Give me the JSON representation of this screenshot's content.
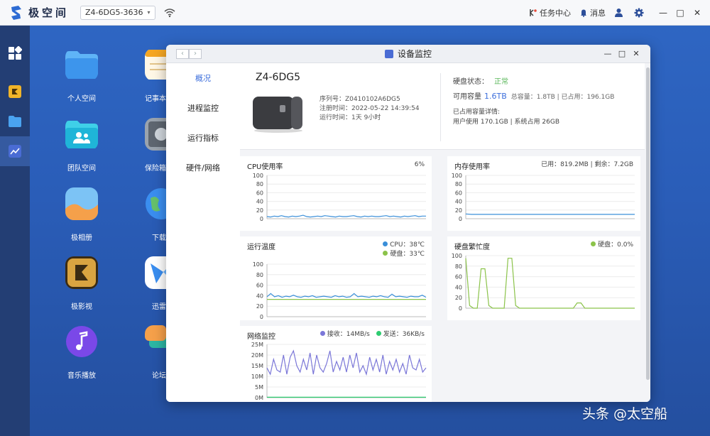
{
  "topbar": {
    "brand": "极空间",
    "device": "Z4-6DG5-3636",
    "tasks": "任务中心",
    "messages": "消息"
  },
  "apps": [
    {
      "label": "个人空间"
    },
    {
      "label": "记事本"
    },
    {
      "label": "团队空间"
    },
    {
      "label": "保险箱"
    },
    {
      "label": "极相册"
    },
    {
      "label": "下载"
    },
    {
      "label": "极影视"
    },
    {
      "label": "迅雷"
    },
    {
      "label": "音乐播放"
    },
    {
      "label": "论坛"
    }
  ],
  "window": {
    "title": "设备监控",
    "nav": [
      "概况",
      "进程监控",
      "运行指标",
      "硬件/网络"
    ],
    "device_name": "Z4-6DG5",
    "serial": "序列号：Z0410102A6DG5",
    "registered": "注册时间：2022-05-22 14:39:54",
    "uptime": "运行时间：1天 9小时",
    "disk_status_label": "硬盘状态：",
    "disk_status": "正常",
    "avail_label": "可用容量",
    "avail_value": "1.6TB",
    "capacity_detail": "总容量：1.8TB | 已占用：196.1GB",
    "used_detail_label": "已占用容量详情:",
    "used_detail": "用户使用 170.1GB | 系统占用 26GB"
  },
  "colors": {
    "accent": "#3d6fdc",
    "cpu_line": "#3a8fd9",
    "disk_line": "#8bc34a",
    "net_recv": "#7b77d8",
    "net_send": "#2ecc71"
  },
  "chart_data": [
    {
      "type": "line",
      "title": "CPU使用率",
      "legend": "6%",
      "ylim": [
        0,
        100
      ],
      "yticks": [
        "100",
        "80",
        "60",
        "40",
        "20",
        "0"
      ],
      "series": [
        {
          "values": [
            5,
            4,
            6,
            5,
            7,
            5,
            4,
            6,
            5,
            6,
            8,
            5,
            4,
            5,
            6,
            5,
            7,
            6,
            5,
            4,
            6,
            5,
            5,
            6,
            7,
            5,
            4,
            6,
            5,
            6,
            5,
            5,
            6,
            7,
            5,
            6,
            5,
            4,
            6,
            5,
            6,
            7,
            5,
            6,
            6
          ]
        }
      ]
    },
    {
      "type": "line",
      "title": "内存使用率",
      "legend": "已用：819.2MB | 剩余：7.2GB",
      "ylim": [
        0,
        100
      ],
      "yticks": [
        "100",
        "80",
        "60",
        "40",
        "20",
        "0"
      ],
      "series": [
        {
          "values": [
            11,
            10,
            10,
            10,
            10,
            10,
            10,
            10,
            10,
            10,
            10,
            10,
            10,
            10,
            10,
            10,
            10,
            10,
            10,
            10,
            10,
            10,
            10,
            10,
            10,
            10,
            10,
            10,
            10,
            10
          ]
        }
      ]
    },
    {
      "type": "line",
      "title": "运行温度",
      "legend_cpu": "CPU：38℃",
      "legend_disk": "硬盘：33℃",
      "ylim": [
        0,
        100
      ],
      "yticks": [
        "100",
        "80",
        "60",
        "40",
        "20",
        "0"
      ],
      "series": [
        {
          "name": "CPU",
          "values": [
            38,
            44,
            38,
            40,
            37,
            39,
            38,
            41,
            38,
            37,
            39,
            38,
            40,
            37,
            38,
            39,
            38,
            37,
            40,
            38,
            39,
            37,
            38,
            44,
            38,
            39,
            38,
            37,
            39,
            38,
            40,
            38,
            37,
            43,
            38,
            39,
            38,
            37,
            39,
            38,
            38,
            41,
            37
          ]
        },
        {
          "name": "硬盘",
          "values": [
            33,
            33,
            33,
            33,
            33,
            33,
            33,
            33,
            33,
            33,
            33,
            33,
            33,
            33,
            33,
            33,
            33,
            33,
            33,
            33,
            33,
            33,
            33,
            33,
            33,
            33,
            33,
            33,
            33,
            33,
            33,
            33,
            33,
            33,
            33,
            33,
            33,
            33,
            33,
            33,
            33,
            33,
            33
          ]
        }
      ]
    },
    {
      "type": "line",
      "title": "硬盘繁忙度",
      "legend": "硬盘：0.0%",
      "ylim": [
        0,
        100
      ],
      "yticks": [
        "100",
        "80",
        "60",
        "40",
        "20",
        "0"
      ],
      "series": [
        {
          "values": [
            95,
            5,
            0,
            0,
            75,
            75,
            5,
            0,
            0,
            0,
            0,
            95,
            95,
            5,
            0,
            0,
            0,
            0,
            0,
            0,
            0,
            0,
            0,
            0,
            0,
            0,
            0,
            0,
            0,
            10,
            10,
            0,
            0,
            0,
            0,
            0,
            0,
            0,
            0,
            0,
            0,
            0,
            0,
            0,
            0
          ]
        }
      ]
    },
    {
      "type": "line",
      "title": "网络监控",
      "legend_recv": "接收：14MB/s",
      "legend_send": "发送：36KB/s",
      "ylim": [
        0,
        25
      ],
      "yticks": [
        "25M",
        "20M",
        "15M",
        "10M",
        "5M",
        "0M"
      ],
      "series": [
        {
          "name": "接收",
          "values": [
            14,
            11,
            18,
            13,
            12,
            20,
            11,
            19,
            22,
            15,
            12,
            18,
            13,
            21,
            11,
            20,
            14,
            12,
            16,
            22,
            12,
            17,
            13,
            19,
            12,
            20,
            14,
            21,
            12,
            15,
            11,
            19,
            13,
            18,
            12,
            20,
            11,
            17,
            13,
            18,
            12,
            16,
            11,
            20,
            14,
            13,
            18,
            12,
            14
          ]
        },
        {
          "name": "发送",
          "values": [
            0.2,
            0.2,
            0.2,
            0.2,
            0.2,
            0.2,
            0.2,
            0.2,
            0.2,
            0.2,
            0.2,
            0.2,
            0.2,
            0.2,
            0.2,
            0.2,
            0.2,
            0.2,
            0.2,
            0.2,
            0.2,
            0.2,
            0.2,
            0.2,
            0.2,
            0.2,
            0.2,
            0.2,
            0.2,
            0.2
          ]
        }
      ]
    }
  ],
  "watermark": "头条 @太空船"
}
